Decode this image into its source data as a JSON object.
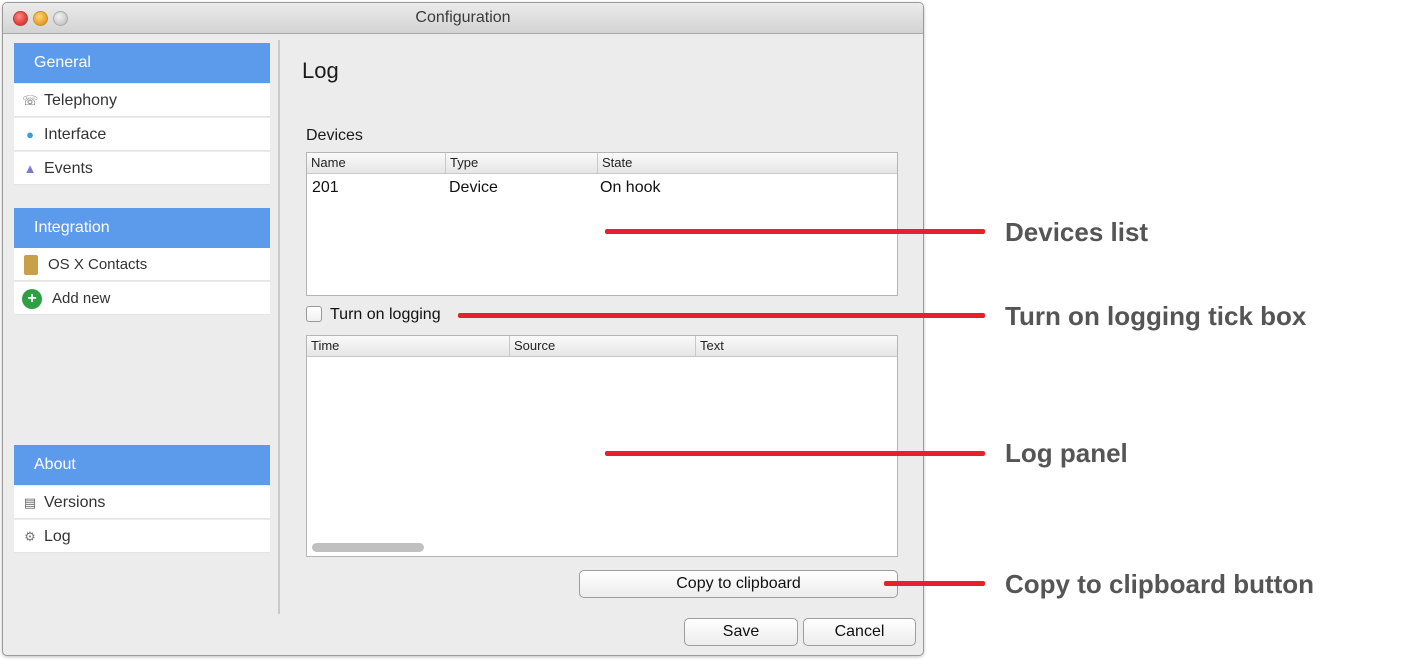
{
  "window": {
    "title": "Configuration"
  },
  "sidebar": {
    "groups": [
      {
        "header": "General",
        "items": [
          {
            "label": "Telephony",
            "icon": "telephony-icon"
          },
          {
            "label": "Interface",
            "icon": "interface-icon"
          },
          {
            "label": "Events",
            "icon": "events-icon"
          }
        ]
      },
      {
        "header": "Integration",
        "items": [
          {
            "label": "OS X Contacts",
            "icon": "contacts-book-icon"
          },
          {
            "label": "Add new",
            "icon": "add-new-plus-icon"
          }
        ]
      },
      {
        "header": "About",
        "items": [
          {
            "label": "Versions",
            "icon": "versions-icon"
          },
          {
            "label": "Log",
            "icon": "log-icon"
          }
        ]
      }
    ]
  },
  "main": {
    "title": "Log",
    "devices": {
      "label": "Devices",
      "columns": [
        "Name",
        "Type",
        "State"
      ],
      "rows": [
        [
          "201",
          "Device",
          "On hook"
        ]
      ]
    },
    "logging_checkbox": {
      "label": "Turn on logging",
      "checked": false
    },
    "log_panel": {
      "columns": [
        "Time",
        "Source",
        "Text"
      ],
      "rows": []
    },
    "copy_button": "Copy to clipboard",
    "save_button": "Save",
    "cancel_button": "Cancel"
  },
  "annotations": {
    "devices_list": "Devices list",
    "logging_tick_box": "Turn on logging tick box",
    "log_panel": "Log panel",
    "copy_button": "Copy to clipboard button",
    "color": "#e8202b"
  },
  "colors": {
    "sidebar_header": "#5c9bec",
    "annotation_line": "#e8202b",
    "annotation_text": "#555555"
  }
}
